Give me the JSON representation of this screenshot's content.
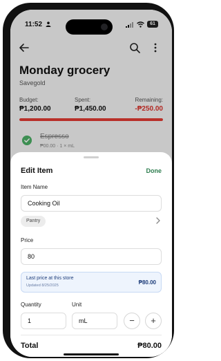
{
  "status_bar": {
    "time": "11:52",
    "battery": "61"
  },
  "list": {
    "title": "Monday grocery",
    "store": "Savegold",
    "budget_label": "Budget:",
    "budget_value": "₱1,200.00",
    "spent_label": "Spent:",
    "spent_value": "₱1,450.00",
    "remaining_label": "Remaining:",
    "remaining_value": "-₱250.00",
    "progress_fraction": 1.0,
    "progress_color": "#e23b33"
  },
  "background_item": {
    "name": "Espresso",
    "sub": "₱00.00 · 1 × mL"
  },
  "sheet": {
    "title": "Edit Item",
    "done_label": "Done",
    "item_name_label": "Item Name",
    "item_name_value": "Cooking Oil",
    "category_chip": "Pantry",
    "price_label": "Price",
    "price_value": "80",
    "last_price": {
      "title": "Last price at this store",
      "date": "Updated 8/25/2025",
      "value": "₱80.00"
    },
    "quantity_label": "Quantity",
    "quantity_value": "1",
    "unit_label": "Unit",
    "unit_value": "mL",
    "minus_label": "−",
    "plus_label": "+",
    "total_label": "Total",
    "total_value": "₱80.00"
  },
  "colors": {
    "accent_green": "#2e7d4f",
    "danger_red": "#d9322b",
    "info_bg": "#eef4fd"
  }
}
